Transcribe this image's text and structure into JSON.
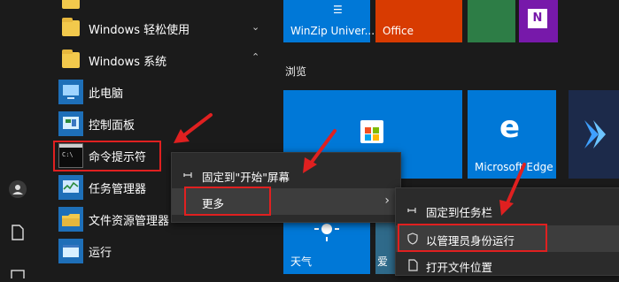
{
  "app_list": {
    "items": [
      {
        "label": "Windows 轻松使用",
        "icon": "folder-icon"
      },
      {
        "label": "Windows 系统",
        "icon": "folder-icon"
      },
      {
        "label": "此电脑",
        "icon": "computer-icon"
      },
      {
        "label": "控制面板",
        "icon": "control-panel-icon"
      },
      {
        "label": "命令提示符",
        "icon": "command-prompt-icon"
      },
      {
        "label": "任务管理器",
        "icon": "task-manager-icon"
      },
      {
        "label": "文件资源管理器",
        "icon": "file-explorer-icon"
      },
      {
        "label": "运行",
        "icon": "run-icon"
      }
    ]
  },
  "tiles": {
    "section_label": "浏览",
    "winzip": "WinZip Univer...",
    "office": "Office",
    "edge": "Microsoft Edge",
    "weather": "天气",
    "partial_tile": "爱"
  },
  "context_menu_1": {
    "pin_start": "固定到\"开始\"屏幕",
    "more": "更多"
  },
  "context_menu_2": {
    "pin_taskbar": "固定到任务栏",
    "run_as_admin": "以管理员身份运行",
    "open_location": "打开文件位置"
  },
  "colors": {
    "background": "#1b1b1b",
    "tile_blue": "#0078d7",
    "office_red": "#d83b01",
    "onenote_purple": "#7719aa",
    "highlight_red": "#e02020",
    "green_tile": "#2d7d46"
  }
}
